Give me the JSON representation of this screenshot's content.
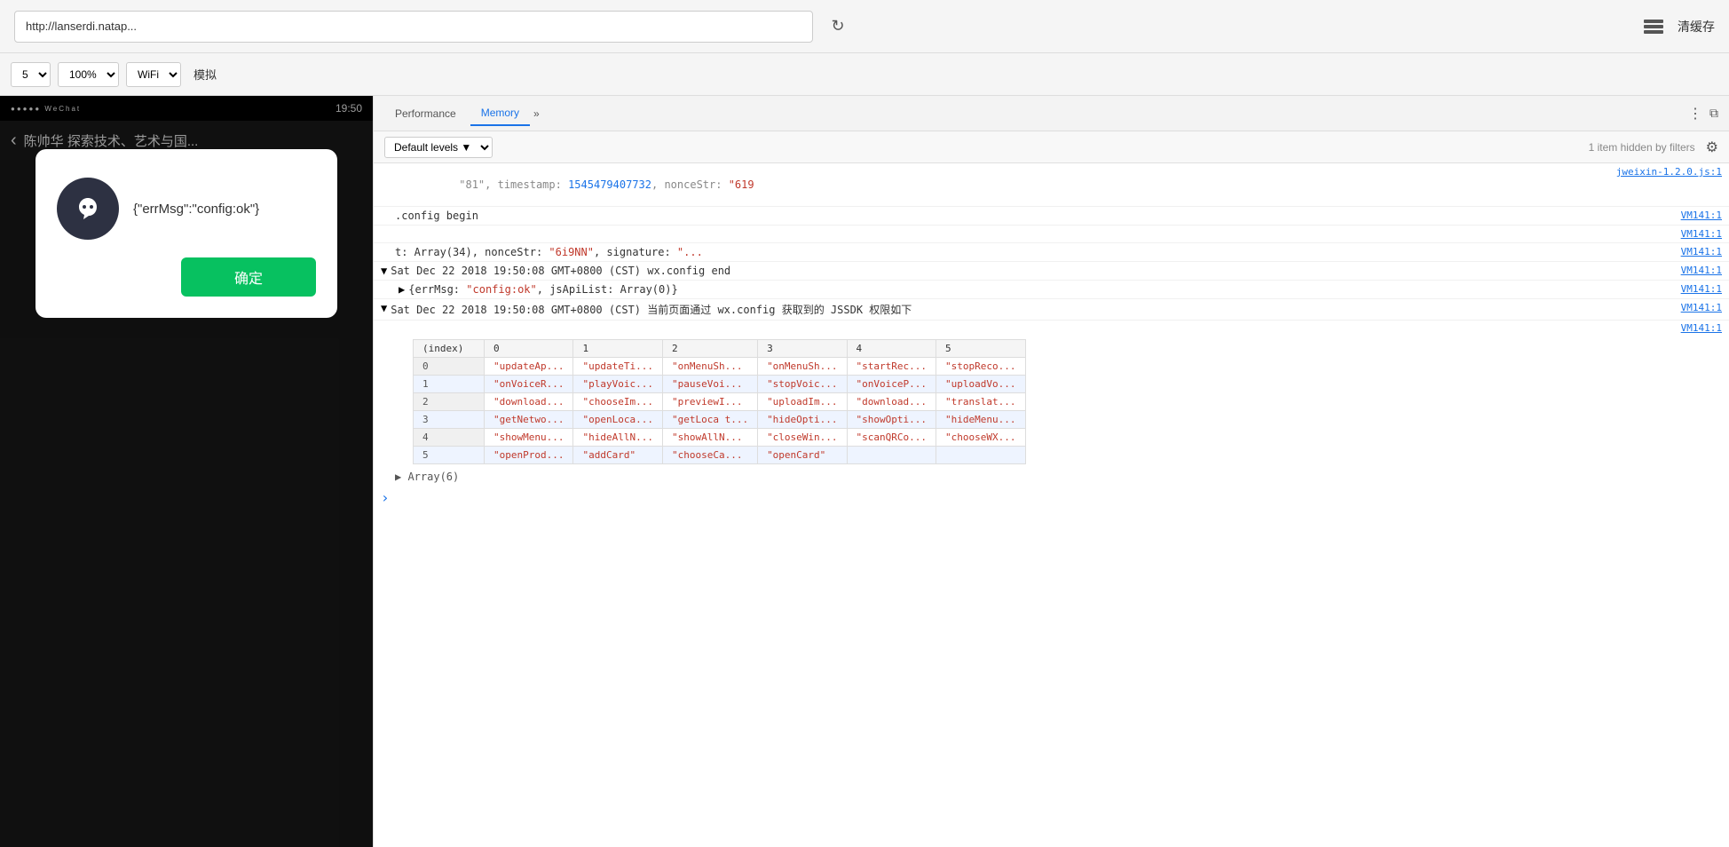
{
  "addressBar": {
    "url": "http://lanserdi.nata",
    "urlFull": "http://lanserdi.natap...",
    "reloadLabel": "↻",
    "clearCacheLabel": "清缓存"
  },
  "toolbar": {
    "deviceLabel": "5",
    "zoomLabel": "100%",
    "networkLabel": "WiFi",
    "simulateLabel": "模拟"
  },
  "phone": {
    "statusLeft": "●●●●● WeChat",
    "statusTime": "19:50",
    "backLabel": "‹",
    "navTitle": "陈帅华 探索技术、艺术与国..."
  },
  "modal": {
    "iconLetter": "ℓ",
    "message": "{\"errMsg\":\"config:ok\"}",
    "confirmLabel": "确定"
  },
  "devtools": {
    "tabs": [
      {
        "label": "Performance",
        "active": false
      },
      {
        "label": "Memory",
        "active": true
      }
    ],
    "moreLabel": "»",
    "filterLevel": "Default levels",
    "filterDropdown": "▼",
    "hiddenText": "1 item hidden by filters",
    "settingsIcon": "⚙"
  },
  "console": {
    "lines": [
      {
        "indent": "",
        "arrow": "",
        "content": "\"81\", timestamp: 1545479407732, nonceStr: \"619...",
        "contentParts": [
          {
            "text": "\"81\", timestamp: ",
            "class": ""
          },
          {
            "text": "1545479407732",
            "class": "text-blue"
          },
          {
            "text": ", nonceStr: ",
            "class": ""
          },
          {
            "text": "\"619",
            "class": "text-red"
          }
        ],
        "source": "jweixin-1.2.0.js:1"
      },
      {
        "arrow": "",
        "content": ".config begin",
        "source": "VM141:1"
      },
      {
        "arrow": "",
        "content": "",
        "source": "VM141:1"
      },
      {
        "arrow": "",
        "content": "t: Array(34), nonceStr: \"6i9NN\", signature: \"...",
        "source": "VM141:1"
      },
      {
        "arrow": "▼",
        "content": "Sat Dec 22 2018 19:50:08 GMT+0800 (CST) wx.config end",
        "source": "VM141:1"
      },
      {
        "arrow": "▶",
        "content": "{errMsg: \"config:ok\", jsApiList: Array(0)}",
        "source": "VM141:1",
        "indentLevel": 1,
        "errMsgRed": "\"config:ok\""
      },
      {
        "arrow": "▼",
        "content": "Sat Dec 22 2018 19:50:08 GMT+0800 (CST) 当前页面通过 wx.config 获取到的 JSSDK 权限如下",
        "source": "VM141:1"
      }
    ],
    "table": {
      "headers": [
        "(index)",
        "0",
        "1",
        "2",
        "3",
        "4",
        "5"
      ],
      "rows": [
        {
          "index": "0",
          "cols": [
            "\"updateAp...",
            "\"updateTi...",
            "\"onMenuSh...",
            "\"onMenuSh...",
            "\"startRec...",
            "\"stopReco..."
          ]
        },
        {
          "index": "1",
          "cols": [
            "\"onVoiceR...",
            "\"playVoic...",
            "\"pauseVoi...",
            "\"stopVoic...",
            "\"onVoiceP...",
            "\"uploadVo..."
          ]
        },
        {
          "index": "2",
          "cols": [
            "\"download...",
            "\"chooseIm...",
            "\"previewI...",
            "\"uploadIm...",
            "\"download...",
            "\"translat..."
          ]
        },
        {
          "index": "3",
          "cols": [
            "\"getNetwo...",
            "\"openLoca...",
            "\"getLoca t...",
            "\"hideOpti...",
            "\"showOpti...",
            "\"hideMenu..."
          ]
        },
        {
          "index": "4",
          "cols": [
            "\"showMenu...",
            "\"hideAllN...",
            "\"showAllN...",
            "\"closeWin...",
            "\"scanQRCo...",
            "\"chooseWX..."
          ]
        },
        {
          "index": "5",
          "cols": [
            "\"openProd...",
            "\"addCard\"",
            "\"chooseCa...",
            "\"openCard\"",
            "",
            ""
          ]
        }
      ]
    },
    "arrayFold": "▶ Array(6)",
    "promptArrow": ">"
  }
}
